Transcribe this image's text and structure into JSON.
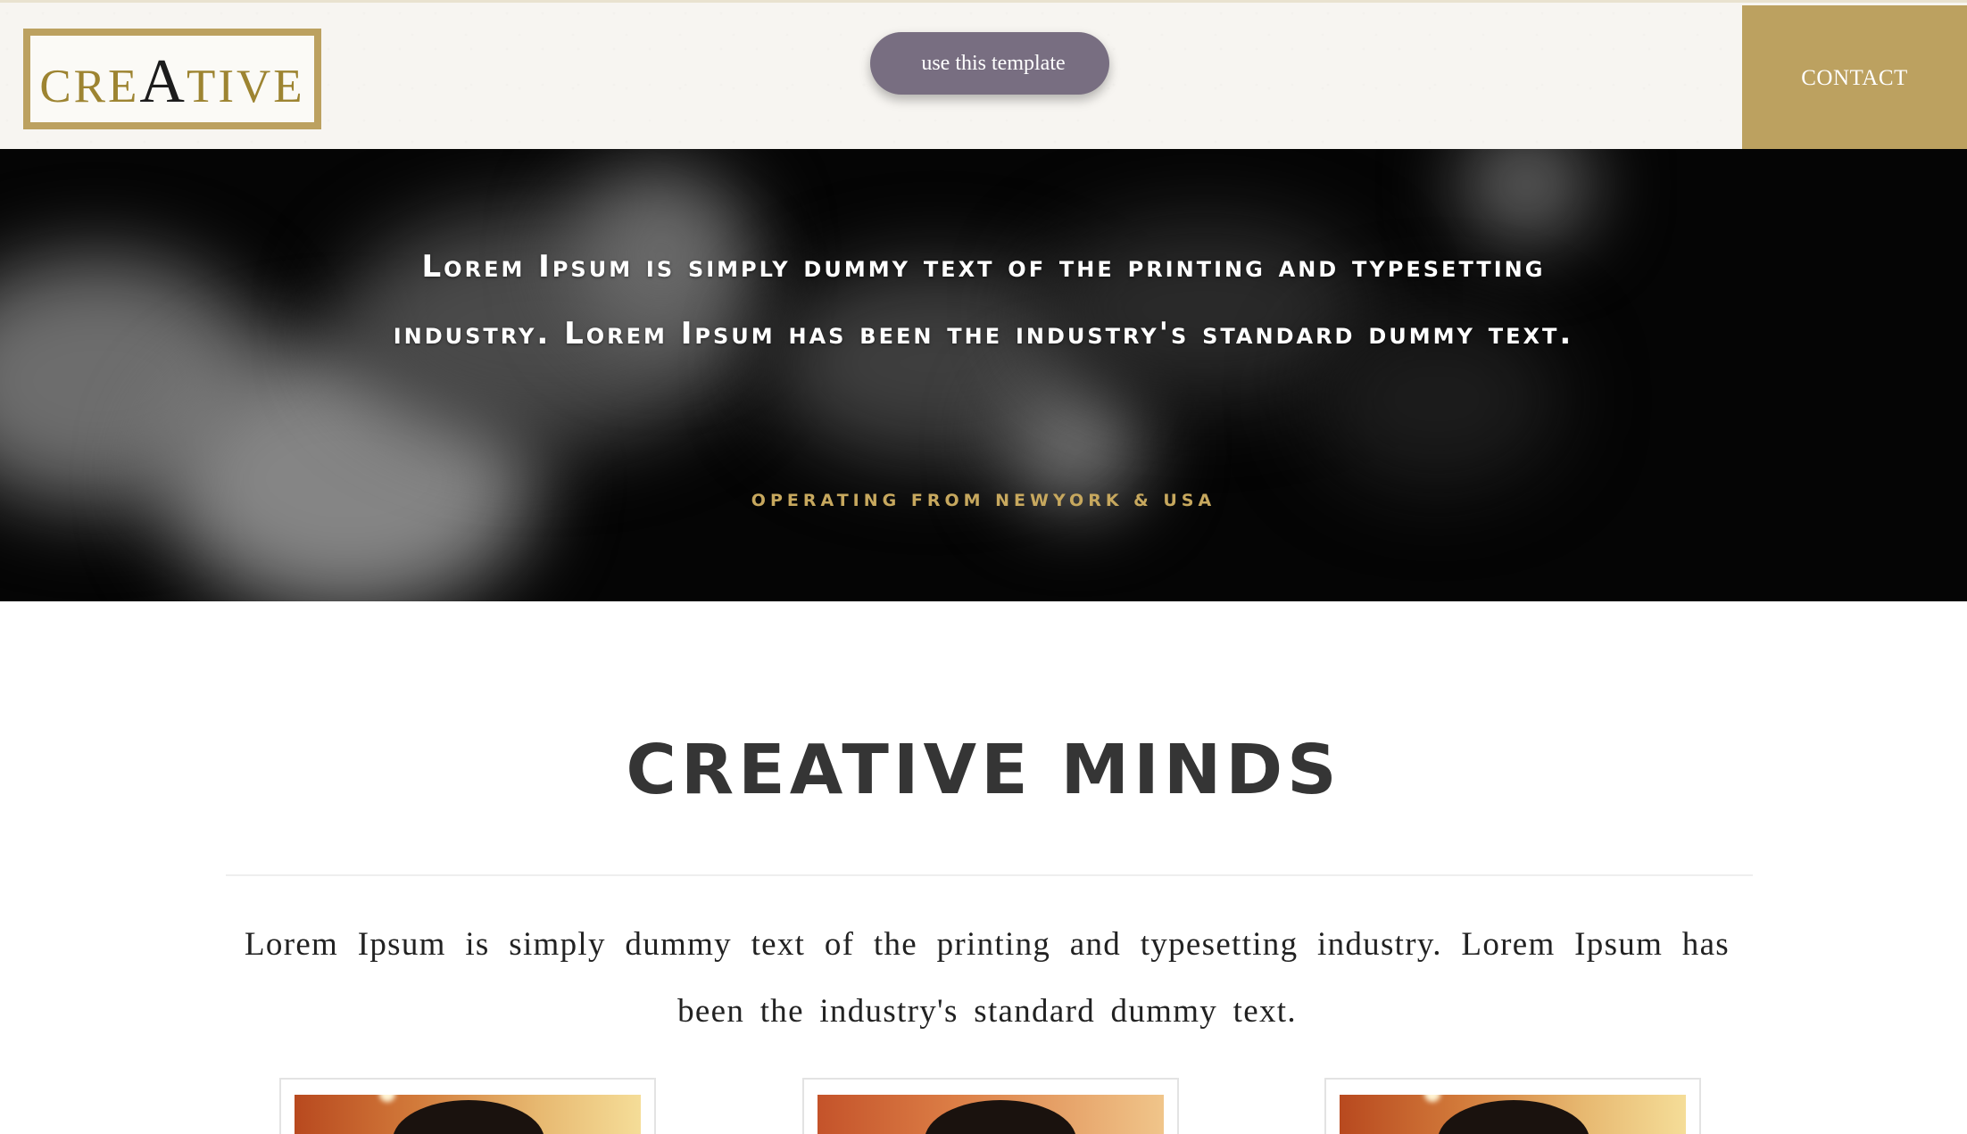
{
  "header": {
    "logo": {
      "prefix": "CRE",
      "highlight": "A",
      "suffix": "TIVE"
    },
    "template_button": "use this template",
    "contact_button": "CONTACT"
  },
  "hero": {
    "text": "Lorem Ipsum is simply dummy text of the printing and typesetting industry. Lorem Ipsum has been the industry's standard dummy text.",
    "subtext": "OPERATING FROM NEWYORK & USA"
  },
  "section": {
    "title": "CREATIVE MINDS",
    "text": "Lorem Ipsum is simply dummy text of the printing and typesetting industry. Lorem Ipsum has been the industry's standard dummy text."
  },
  "colors": {
    "gold": "#bca160",
    "button_purple": "#786e81",
    "hero_bg": "#050505",
    "heading": "#353535"
  }
}
